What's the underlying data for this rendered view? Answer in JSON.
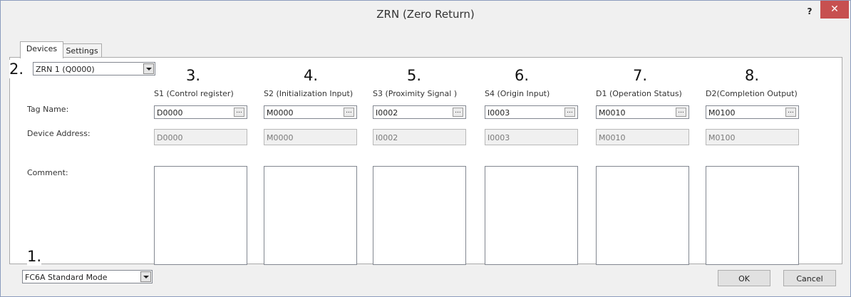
{
  "window": {
    "title": "ZRN (Zero Return)",
    "help": "?",
    "close": "✕"
  },
  "tabs": [
    {
      "label": "Devices"
    },
    {
      "label": "Settings"
    }
  ],
  "instruction_combo": {
    "value": "ZRN 1 (Q0000)"
  },
  "mode_combo": {
    "value": "FC6A Standard Mode"
  },
  "steps": [
    "1.",
    "2.",
    "3.",
    "4.",
    "5.",
    "6.",
    "7.",
    "8."
  ],
  "row_labels": {
    "tag_name": "Tag Name:",
    "device_address": "Device Address:",
    "comment": "Comment:"
  },
  "devices": [
    {
      "header": "S1 (Control register)",
      "tag": "D0000",
      "address": "D0000"
    },
    {
      "header": "S2 (Initialization Input)",
      "tag": "M0000",
      "address": "M0000"
    },
    {
      "header": "S3 (Proximity Signal )",
      "tag": "I0002",
      "address": "I0002"
    },
    {
      "header": "S4 (Origin Input)",
      "tag": "I0003",
      "address": "I0003"
    },
    {
      "header": "D1 (Operation Status)",
      "tag": "M0010",
      "address": "M0010"
    },
    {
      "header": "D2(Completion Output)",
      "tag": "M0100",
      "address": "M0100"
    }
  ],
  "browse_label": "...",
  "buttons": {
    "ok": "OK",
    "cancel": "Cancel"
  }
}
